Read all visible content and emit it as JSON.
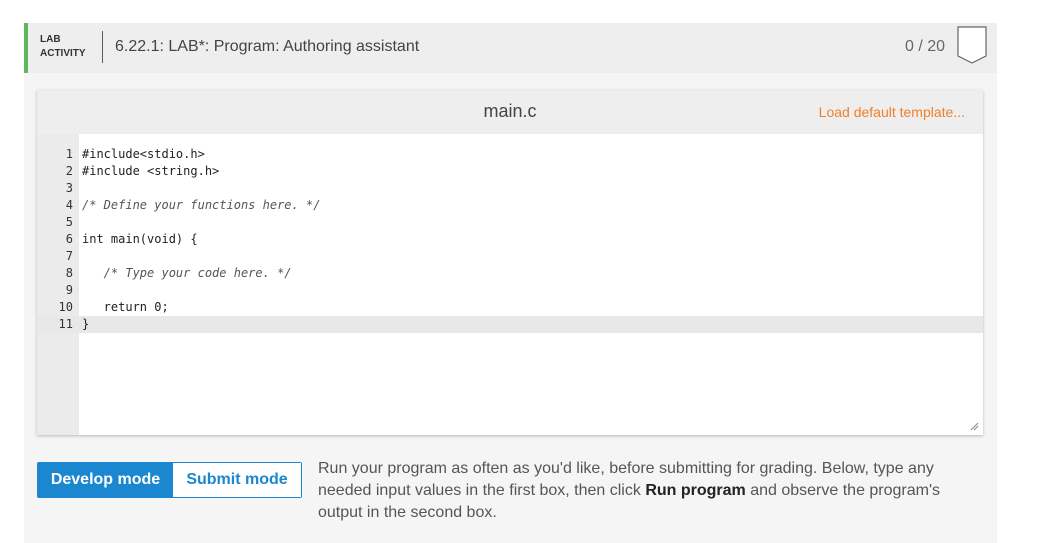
{
  "header": {
    "activity_type_line1": "LAB",
    "activity_type_line2": "ACTIVITY",
    "title": "6.22.1: LAB*: Program: Authoring assistant",
    "score": "0 / 20"
  },
  "editor": {
    "file_name": "main.c",
    "load_template_label": "Load default template...",
    "lines": [
      {
        "num": "1",
        "text": "#include<stdio.h>"
      },
      {
        "num": "2",
        "text": "#include <string.h>"
      },
      {
        "num": "3",
        "text": ""
      },
      {
        "num": "4",
        "text": "/* Define your functions here. */"
      },
      {
        "num": "5",
        "text": ""
      },
      {
        "num": "6",
        "text": "int main(void) {"
      },
      {
        "num": "7",
        "text": ""
      },
      {
        "num": "8",
        "text": "   /* Type your code here. */"
      },
      {
        "num": "9",
        "text": ""
      },
      {
        "num": "10",
        "text": "   return 0;"
      },
      {
        "num": "11",
        "text": "}"
      }
    ]
  },
  "modes": {
    "develop_label": "Develop mode",
    "submit_label": "Submit mode",
    "active": "Develop mode"
  },
  "instructions": {
    "before": "Run your program as often as you'd like, before submitting for grading. Below, type any needed input values in the first box, then click ",
    "bold": "Run program",
    "after": " and observe the program's output in the second box."
  },
  "colors": {
    "accent_green": "#5cb85c",
    "primary_blue": "#1b87d0",
    "link_orange": "#f07f29"
  }
}
